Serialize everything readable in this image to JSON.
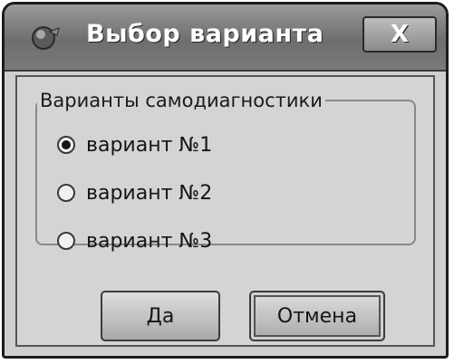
{
  "window": {
    "title": "Выбор варианта",
    "close_label": "X"
  },
  "group": {
    "label": "Варианты самодиагностики",
    "options": [
      {
        "label": "вариант №1",
        "selected": true
      },
      {
        "label": "вариант №2",
        "selected": false
      },
      {
        "label": "вариант №3",
        "selected": false
      }
    ]
  },
  "buttons": {
    "ok_label": "Да",
    "cancel_label": "Отмена"
  },
  "icons": {
    "app": "app-icon",
    "close": "close-icon",
    "radio_selected": "radio-selected-icon",
    "radio_unselected": "radio-unselected-icon"
  }
}
